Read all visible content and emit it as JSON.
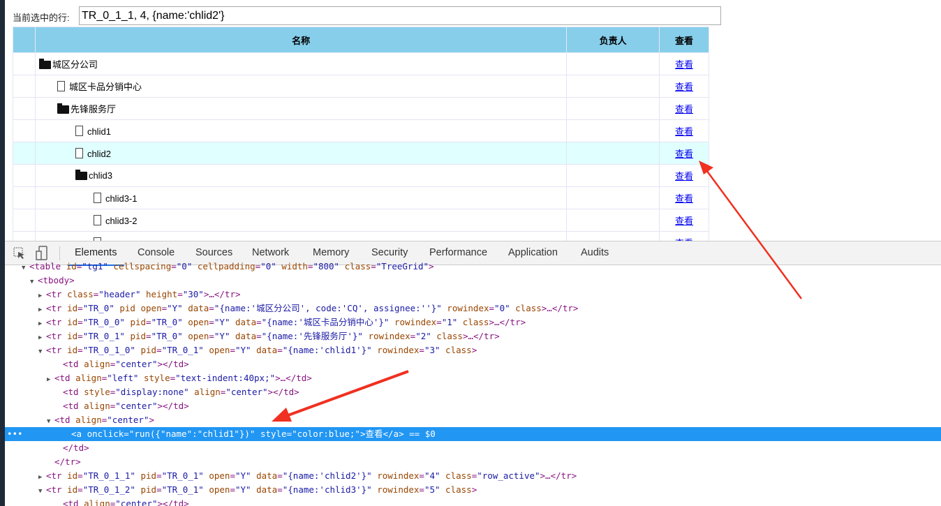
{
  "selection": {
    "label": "当前选中的行:",
    "value": "TR_0_1_1, 4, {name:'chlid2'}"
  },
  "table": {
    "headers": [
      "",
      "名称",
      "负责人",
      "查看"
    ],
    "rows": [
      {
        "name": "城区分公司",
        "icon": "folder",
        "level": 0,
        "link": "查看"
      },
      {
        "name": "城区卡品分销中心",
        "icon": "file",
        "level": 1,
        "link": "查看"
      },
      {
        "name": "先锋服务厅",
        "icon": "folder",
        "level": 1,
        "link": "查看"
      },
      {
        "name": "chlid1",
        "icon": "file",
        "level": 2,
        "link": "查看"
      },
      {
        "name": "chlid2",
        "icon": "file",
        "level": 2,
        "link": "查看",
        "active": true
      },
      {
        "name": "chlid3",
        "icon": "folder",
        "level": 2,
        "link": "查看"
      },
      {
        "name": "chlid3-1",
        "icon": "file",
        "level": 3,
        "link": "查看"
      },
      {
        "name": "chlid3-2",
        "icon": "file",
        "level": 3,
        "link": "查看"
      },
      {
        "name": "",
        "icon": "file",
        "level": 3,
        "link": "查看"
      }
    ]
  },
  "devtools": {
    "tabs": [
      "Elements",
      "Console",
      "Sources",
      "Network",
      "Memory",
      "Security",
      "Performance",
      "Application",
      "Audits"
    ],
    "active_tab": "Elements",
    "lines": [
      {
        "i": 3,
        "a": "▼",
        "t": [
          [
            "tg",
            "<table "
          ],
          [
            "at",
            "id"
          ],
          [
            "tg",
            "="
          ],
          [
            "vl",
            "\"tg1\""
          ],
          [
            "at",
            " cellspacing"
          ],
          [
            "tg",
            "="
          ],
          [
            "vl",
            "\"0\""
          ],
          [
            "at",
            " cellpadding"
          ],
          [
            "tg",
            "="
          ],
          [
            "vl",
            "\"0\""
          ],
          [
            "at",
            " width"
          ],
          [
            "tg",
            "="
          ],
          [
            "vl",
            "\"800\""
          ],
          [
            "at",
            " class"
          ],
          [
            "tg",
            "="
          ],
          [
            "vl",
            "\"TreeGrid\""
          ],
          [
            "tg",
            ">"
          ]
        ]
      },
      {
        "i": 4,
        "a": "▼",
        "t": [
          [
            "tg",
            "<tbody>"
          ]
        ]
      },
      {
        "i": 5,
        "a": "▶",
        "t": [
          [
            "tg",
            "<tr "
          ],
          [
            "at",
            "class"
          ],
          [
            "tg",
            "="
          ],
          [
            "vl",
            "\"header\""
          ],
          [
            "at",
            " height"
          ],
          [
            "tg",
            "="
          ],
          [
            "vl",
            "\"30\""
          ],
          [
            "tg",
            ">…</tr>"
          ]
        ]
      },
      {
        "i": 5,
        "a": "▶",
        "t": [
          [
            "tg",
            "<tr "
          ],
          [
            "at",
            "id"
          ],
          [
            "tg",
            "="
          ],
          [
            "vl",
            "\"TR_0\""
          ],
          [
            "at",
            " pid open"
          ],
          [
            "tg",
            "="
          ],
          [
            "vl",
            "\"Y\""
          ],
          [
            "at",
            " data"
          ],
          [
            "tg",
            "="
          ],
          [
            "vl",
            "\"{name:'城区分公司', code:'CQ', assignee:''}\""
          ],
          [
            "at",
            " rowindex"
          ],
          [
            "tg",
            "="
          ],
          [
            "vl",
            "\"0\""
          ],
          [
            "at",
            " class"
          ],
          [
            "tg",
            ">…</tr>"
          ]
        ]
      },
      {
        "i": 5,
        "a": "▶",
        "t": [
          [
            "tg",
            "<tr "
          ],
          [
            "at",
            "id"
          ],
          [
            "tg",
            "="
          ],
          [
            "vl",
            "\"TR_0_0\""
          ],
          [
            "at",
            " pid"
          ],
          [
            "tg",
            "="
          ],
          [
            "vl",
            "\"TR_0\""
          ],
          [
            "at",
            " open"
          ],
          [
            "tg",
            "="
          ],
          [
            "vl",
            "\"Y\""
          ],
          [
            "at",
            " data"
          ],
          [
            "tg",
            "="
          ],
          [
            "vl",
            "\"{name:'城区卡品分销中心'}\""
          ],
          [
            "at",
            " rowindex"
          ],
          [
            "tg",
            "="
          ],
          [
            "vl",
            "\"1\""
          ],
          [
            "at",
            " class"
          ],
          [
            "tg",
            ">…</tr>"
          ]
        ]
      },
      {
        "i": 5,
        "a": "▶",
        "t": [
          [
            "tg",
            "<tr "
          ],
          [
            "at",
            "id"
          ],
          [
            "tg",
            "="
          ],
          [
            "vl",
            "\"TR_0_1\""
          ],
          [
            "at",
            " pid"
          ],
          [
            "tg",
            "="
          ],
          [
            "vl",
            "\"TR_0\""
          ],
          [
            "at",
            " open"
          ],
          [
            "tg",
            "="
          ],
          [
            "vl",
            "\"Y\""
          ],
          [
            "at",
            " data"
          ],
          [
            "tg",
            "="
          ],
          [
            "vl",
            "\"{name:'先锋服务厅'}\""
          ],
          [
            "at",
            " rowindex"
          ],
          [
            "tg",
            "="
          ],
          [
            "vl",
            "\"2\""
          ],
          [
            "at",
            " class"
          ],
          [
            "tg",
            ">…</tr>"
          ]
        ]
      },
      {
        "i": 5,
        "a": "▼",
        "t": [
          [
            "tg",
            "<tr "
          ],
          [
            "at",
            "id"
          ],
          [
            "tg",
            "="
          ],
          [
            "vl",
            "\"TR_0_1_0\""
          ],
          [
            "at",
            " pid"
          ],
          [
            "tg",
            "="
          ],
          [
            "vl",
            "\"TR_0_1\""
          ],
          [
            "at",
            " open"
          ],
          [
            "tg",
            "="
          ],
          [
            "vl",
            "\"Y\""
          ],
          [
            "at",
            " data"
          ],
          [
            "tg",
            "="
          ],
          [
            "vl",
            "\"{name:'chlid1'}\""
          ],
          [
            "at",
            " rowindex"
          ],
          [
            "tg",
            "="
          ],
          [
            "vl",
            "\"3\""
          ],
          [
            "at",
            " class"
          ],
          [
            "tg",
            ">"
          ]
        ]
      },
      {
        "i": 7,
        "a": "",
        "t": [
          [
            "tg",
            "<td "
          ],
          [
            "at",
            "align"
          ],
          [
            "tg",
            "="
          ],
          [
            "vl",
            "\"center\""
          ],
          [
            "tg",
            "></td>"
          ]
        ]
      },
      {
        "i": 6,
        "a": "▶",
        "t": [
          [
            "tg",
            "<td "
          ],
          [
            "at",
            "align"
          ],
          [
            "tg",
            "="
          ],
          [
            "vl",
            "\"left\""
          ],
          [
            "at",
            " style"
          ],
          [
            "tg",
            "="
          ],
          [
            "vl",
            "\"text-indent:40px;\""
          ],
          [
            "tg",
            ">…</td>"
          ]
        ]
      },
      {
        "i": 7,
        "a": "",
        "t": [
          [
            "tg",
            "<td "
          ],
          [
            "at",
            "style"
          ],
          [
            "tg",
            "="
          ],
          [
            "vl",
            "\"display:none\""
          ],
          [
            "at",
            " align"
          ],
          [
            "tg",
            "="
          ],
          [
            "vl",
            "\"center\""
          ],
          [
            "tg",
            "></td>"
          ]
        ]
      },
      {
        "i": 7,
        "a": "",
        "t": [
          [
            "tg",
            "<td "
          ],
          [
            "at",
            "align"
          ],
          [
            "tg",
            "="
          ],
          [
            "vl",
            "\"center\""
          ],
          [
            "tg",
            "></td>"
          ]
        ]
      },
      {
        "i": 6,
        "a": "▼",
        "t": [
          [
            "tg",
            "<td "
          ],
          [
            "at",
            "align"
          ],
          [
            "tg",
            "="
          ],
          [
            "vl",
            "\"center\""
          ],
          [
            "tg",
            ">"
          ]
        ]
      },
      {
        "i": 8,
        "a": "",
        "sel": true,
        "t": [
          [
            "tg",
            "<a "
          ],
          [
            "at",
            "onclick"
          ],
          [
            "tg",
            "="
          ],
          [
            "vl",
            "\"run({\"name\":\"chlid1\"})\""
          ],
          [
            "at",
            " style"
          ],
          [
            "tg",
            "="
          ],
          [
            "vl",
            "\"color:blue;\""
          ],
          [
            "tg",
            ">"
          ],
          [
            "pl",
            "查看"
          ],
          [
            "tg",
            "</a>"
          ],
          [
            "eq",
            " == $0"
          ]
        ]
      },
      {
        "i": 7,
        "a": "",
        "t": [
          [
            "tg",
            "</td>"
          ]
        ]
      },
      {
        "i": 6,
        "a": "",
        "t": [
          [
            "tg",
            "</tr>"
          ]
        ]
      },
      {
        "i": 5,
        "a": "▶",
        "t": [
          [
            "tg",
            "<tr "
          ],
          [
            "at",
            "id"
          ],
          [
            "tg",
            "="
          ],
          [
            "vl",
            "\"TR_0_1_1\""
          ],
          [
            "at",
            " pid"
          ],
          [
            "tg",
            "="
          ],
          [
            "vl",
            "\"TR_0_1\""
          ],
          [
            "at",
            " open"
          ],
          [
            "tg",
            "="
          ],
          [
            "vl",
            "\"Y\""
          ],
          [
            "at",
            " data"
          ],
          [
            "tg",
            "="
          ],
          [
            "vl",
            "\"{name:'chlid2'}\""
          ],
          [
            "at",
            " rowindex"
          ],
          [
            "tg",
            "="
          ],
          [
            "vl",
            "\"4\""
          ],
          [
            "at",
            " class"
          ],
          [
            "tg",
            "="
          ],
          [
            "vl",
            "\"row_active\""
          ],
          [
            "tg",
            ">…</tr>"
          ]
        ]
      },
      {
        "i": 5,
        "a": "▼",
        "t": [
          [
            "tg",
            "<tr "
          ],
          [
            "at",
            "id"
          ],
          [
            "tg",
            "="
          ],
          [
            "vl",
            "\"TR_0_1_2\""
          ],
          [
            "at",
            " pid"
          ],
          [
            "tg",
            "="
          ],
          [
            "vl",
            "\"TR_0_1\""
          ],
          [
            "at",
            " open"
          ],
          [
            "tg",
            "="
          ],
          [
            "vl",
            "\"Y\""
          ],
          [
            "at",
            " data"
          ],
          [
            "tg",
            "="
          ],
          [
            "vl",
            "\"{name:'chlid3'}\""
          ],
          [
            "at",
            " rowindex"
          ],
          [
            "tg",
            "="
          ],
          [
            "vl",
            "\"5\""
          ],
          [
            "at",
            " class"
          ],
          [
            "tg",
            ">"
          ]
        ]
      },
      {
        "i": 7,
        "a": "",
        "t": [
          [
            "tg",
            "<td "
          ],
          [
            "at",
            "align"
          ],
          [
            "tg",
            "="
          ],
          [
            "vl",
            "\"center\""
          ],
          [
            "tg",
            "></td>"
          ]
        ]
      }
    ]
  },
  "colors": {
    "header": "#87ceeb",
    "active_row": "#e0ffff",
    "selected_line": "#2196f3",
    "annotation_arrow": "#f03020"
  }
}
